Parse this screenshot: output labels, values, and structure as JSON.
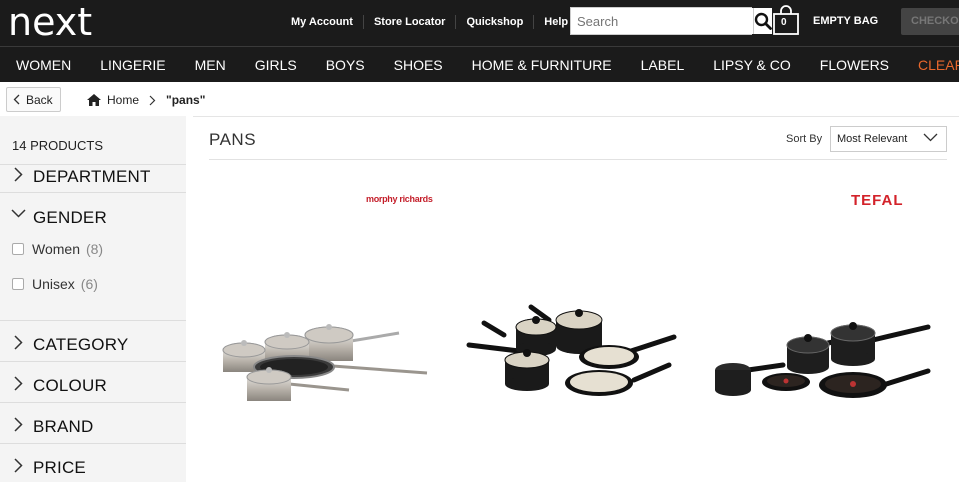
{
  "header": {
    "logo": "next",
    "links": [
      "My Account",
      "Store Locator",
      "Quickshop",
      "Help"
    ],
    "search_placeholder": "Search",
    "bag_count": "0",
    "bag_label": "EMPTY BAG",
    "checkout_label": "CHECKOUT"
  },
  "nav": {
    "items": [
      "WOMEN",
      "LINGERIE",
      "MEN",
      "GIRLS",
      "BOYS",
      "SHOES",
      "HOME & FURNITURE",
      "LABEL",
      "LIPSY & CO",
      "FLOWERS",
      "CLEARANCE"
    ]
  },
  "breadcrumb": {
    "back_label": "Back",
    "home_label": "Home",
    "current": "\"pans\""
  },
  "sidebar": {
    "product_count": "14 PRODUCTS",
    "filters": {
      "department": "DEPARTMENT",
      "gender": "GENDER",
      "category": "CATEGORY",
      "colour": "COLOUR",
      "brand": "BRAND",
      "price": "PRICE"
    },
    "gender_options": [
      {
        "label": "Women",
        "count": "(8)"
      },
      {
        "label": "Unisex",
        "count": "(6)"
      }
    ]
  },
  "main": {
    "title": "PANS",
    "sort_label": "Sort By",
    "sort_value": "Most Relevant"
  },
  "products": [
    {
      "brand": "morphy richards"
    },
    {
      "brand": ""
    },
    {
      "brand": "TEFAL"
    }
  ]
}
